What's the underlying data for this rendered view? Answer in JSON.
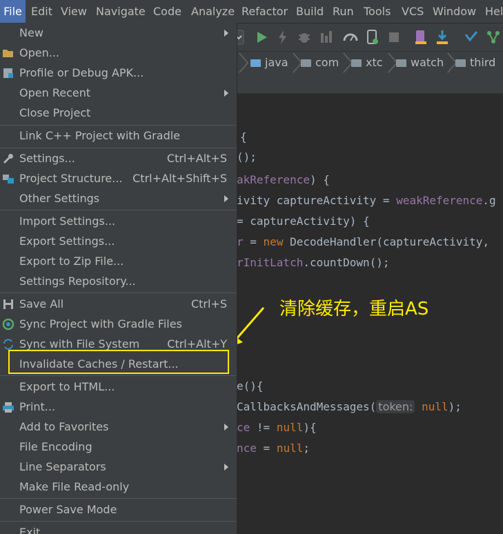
{
  "menubar": {
    "items": [
      "File",
      "Edit",
      "View",
      "Navigate",
      "Code",
      "Analyze",
      "Refactor",
      "Build",
      "Run",
      "Tools",
      "VCS",
      "Window",
      "Hel"
    ]
  },
  "breadcrumb": [
    "java",
    "com",
    "xtc",
    "watch",
    "third"
  ],
  "code_lines": {
    "l1": "{",
    "l2": "();",
    "l3a": "akReference",
    "l3b": ") {",
    "l4a": "ivity captureActivity = ",
    "l4b": "weakReference",
    "l4c": ".g",
    "l5": "= captureActivity) {",
    "l6a": "r",
    "l6b": " = ",
    "l6c": "new",
    "l6d": " DecodeHandler(captureActivity, ",
    "l7a": "rInitLatch",
    "l7b": ".countDown();",
    "l8": "e(){",
    "l9a": "CallbacksAndMessages(",
    "l9hint": "token:",
    "l9b": " null",
    "l9c": ");",
    "l10a": "ce",
    "l10b": " != ",
    "l10c": "null",
    "l10d": "){",
    "l11a": "nce",
    "l11b": " = ",
    "l11c": "null",
    "l11d": ";"
  },
  "annotation": "清除缓存，重启AS",
  "file_menu": {
    "new": "New",
    "open": "Open...",
    "profile": "Profile or Debug APK...",
    "open_recent": "Open Recent",
    "close_project": "Close Project",
    "link_cpp": "Link C++ Project with Gradle",
    "settings": "Settings...",
    "settings_sc": "Ctrl+Alt+S",
    "project_structure": "Project Structure...",
    "project_structure_sc": "Ctrl+Alt+Shift+S",
    "other_settings": "Other Settings",
    "import_settings": "Import Settings...",
    "export_settings": "Export Settings...",
    "export_zip": "Export to Zip File...",
    "settings_repo": "Settings Repository...",
    "save_all": "Save All",
    "save_all_sc": "Ctrl+S",
    "sync_gradle": "Sync Project with Gradle Files",
    "sync_fs": "Sync with File System",
    "sync_fs_sc": "Ctrl+Alt+Y",
    "invalidate": "Invalidate Caches / Restart...",
    "export_html": "Export to HTML...",
    "print": "Print...",
    "add_favorites": "Add to Favorites",
    "file_encoding": "File Encoding",
    "line_separators": "Line Separators",
    "make_readonly": "Make File Read-only",
    "power_save": "Power Save Mode",
    "exit": "Exit"
  },
  "colors": {
    "menu_bg": "#3c3f41",
    "editor_bg": "#2b2b2b",
    "selection": "#4b6eaf",
    "annotation": "#ffeb00"
  }
}
